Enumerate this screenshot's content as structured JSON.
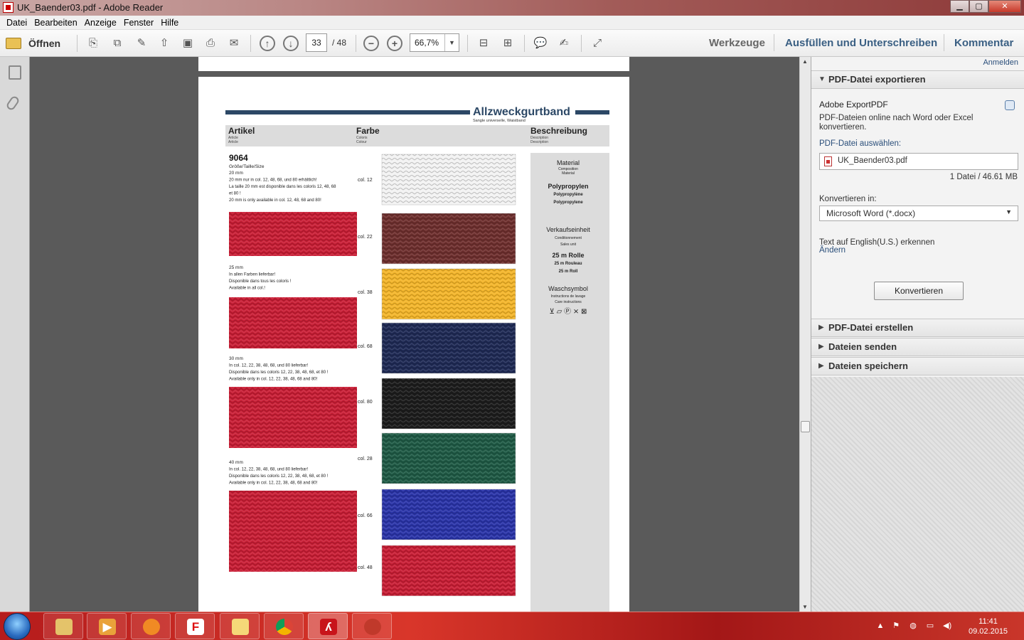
{
  "window": {
    "title": "UK_Baender03.pdf - Adobe Reader",
    "min": "▁",
    "max": "▢",
    "close": "✕"
  },
  "menu": [
    "Datei",
    "Bearbeiten",
    "Anzeige",
    "Fenster",
    "Hilfe"
  ],
  "toolbar": {
    "open_label": "Öffnen",
    "page_current": "33",
    "page_total": "/ 48",
    "zoom": "66,7%",
    "tools_label": "Werkzeuge",
    "fill_sign_label": "Ausfüllen und Unterschreiben",
    "comment_label": "Kommentar",
    "icons": [
      "create-pdf-icon",
      "combine-icon",
      "edit-icon",
      "upload-icon",
      "save-icon",
      "print-icon",
      "mail-icon",
      "prev-page-icon",
      "next-page-icon",
      "zoom-out-icon",
      "zoom-in-icon",
      "fit-page-icon",
      "fit-width-icon",
      "comment-bubble-icon",
      "highlight-icon",
      "fullscreen-icon"
    ]
  },
  "document": {
    "header_title": "Allzweckgurtband",
    "header_sub": "Sangle universelle, Waistband",
    "columns": {
      "artikel": "Artikel",
      "artikel_sub1": "Article",
      "artikel_sub2": "Article",
      "farbe": "Farbe",
      "farbe_sub1": "Coloris",
      "farbe_sub2": "Colour",
      "beschreibung": "Beschreibung",
      "beschreibung_sub1": "Description",
      "beschreibung_sub2": "Description"
    },
    "article_no": "9064",
    "size_label": "Größe/Taille/Size",
    "sizes": [
      {
        "title": "20 mm",
        "lines": [
          "20 mm nur in col. 12, 48, 68, und 80 erhältlich!",
          "La taille 20 mm est disponible dans les coloris 12, 48, 68",
          "et 80 !",
          "20 mm is only available in col. 12, 48, 68 and 80!"
        ]
      },
      {
        "title": "25 mm",
        "lines": [
          "In allen Farben lieferbar!",
          "Disponible dans tous les coloris !",
          "Available in all col.!"
        ]
      },
      {
        "title": "30 mm",
        "lines": [
          "In col. 12, 22, 38, 48, 68, und 80 lieferbar!",
          "Disponible dans les coloris 12, 22, 38, 48, 68, et 80 !",
          "Available only in col. 12, 22, 38, 48, 68 and 80!"
        ]
      },
      {
        "title": "40 mm",
        "lines": [
          "In col. 12, 22, 38, 48, 68, und 80 lieferbar!",
          "Disponible dans les coloris 12, 22, 38, 48, 68, et 80 !",
          "Available only in col. 12, 22, 38, 48, 68 and 80!"
        ]
      }
    ],
    "swatches": [
      {
        "label": "col. 12",
        "color": "#f2f2f2"
      },
      {
        "label": "col. 22",
        "color": "#6e2f2e"
      },
      {
        "label": "col. 38",
        "color": "#f3b52a"
      },
      {
        "label": "col. 68",
        "color": "#1f2a55"
      },
      {
        "label": "col. 80",
        "color": "#1c1c1c"
      },
      {
        "label": "col. 28",
        "color": "#1f5a45"
      },
      {
        "label": "col. 66",
        "color": "#2a34a8"
      },
      {
        "label": "col. 48",
        "color": "#c81e35"
      }
    ],
    "extra_labels": [
      "col. 28"
    ],
    "sample_color": "#c81e35",
    "description": {
      "material": "Material",
      "material_sub1": "Composition",
      "material_sub2": "Material",
      "material_val": "Polypropylen",
      "material_val2": "Polypropylène",
      "material_val3": "Polypropylene",
      "unit": "Verkaufseinheit",
      "unit_sub1": "Conditionnement",
      "unit_sub2": "Sales unit",
      "unit_val": "25 m Rolle",
      "unit_val2": "25 m Rouleau",
      "unit_val3": "25 m Roll",
      "wash": "Waschsymbol",
      "wash_sub1": "Instructions de lavage",
      "wash_sub2": "Care instructions",
      "wash_icons": "⊻ ⏥ Ⓟ ⨯ ⊠"
    }
  },
  "panel": {
    "signin": "Anmelden",
    "export_header": "PDF-Datei exportieren",
    "export_title": "Adobe ExportPDF",
    "export_desc1": "PDF-Dateien online nach Word oder Excel",
    "export_desc2": "konvertieren.",
    "select_label": "PDF-Datei auswählen:",
    "file_name": "UK_Baender03.pdf",
    "file_info": "1 Datei / 46.61 MB",
    "convert_to_label": "Konvertieren in:",
    "convert_to_value": "Microsoft Word (*.docx)",
    "ocr_text": "Text auf English(U.S.) erkennen",
    "change_link": "Ändern",
    "convert_button": "Konvertieren",
    "sections": [
      "PDF-Datei erstellen",
      "Dateien senden",
      "Dateien speichern"
    ]
  },
  "taskbar": {
    "time": "11:41",
    "date": "09.02.2015",
    "apps": [
      "explorer-icon",
      "media-player-icon",
      "firefox-icon",
      "f-app-icon",
      "notes-icon",
      "chrome-icon",
      "adobe-reader-icon",
      "other-app-icon"
    ]
  }
}
